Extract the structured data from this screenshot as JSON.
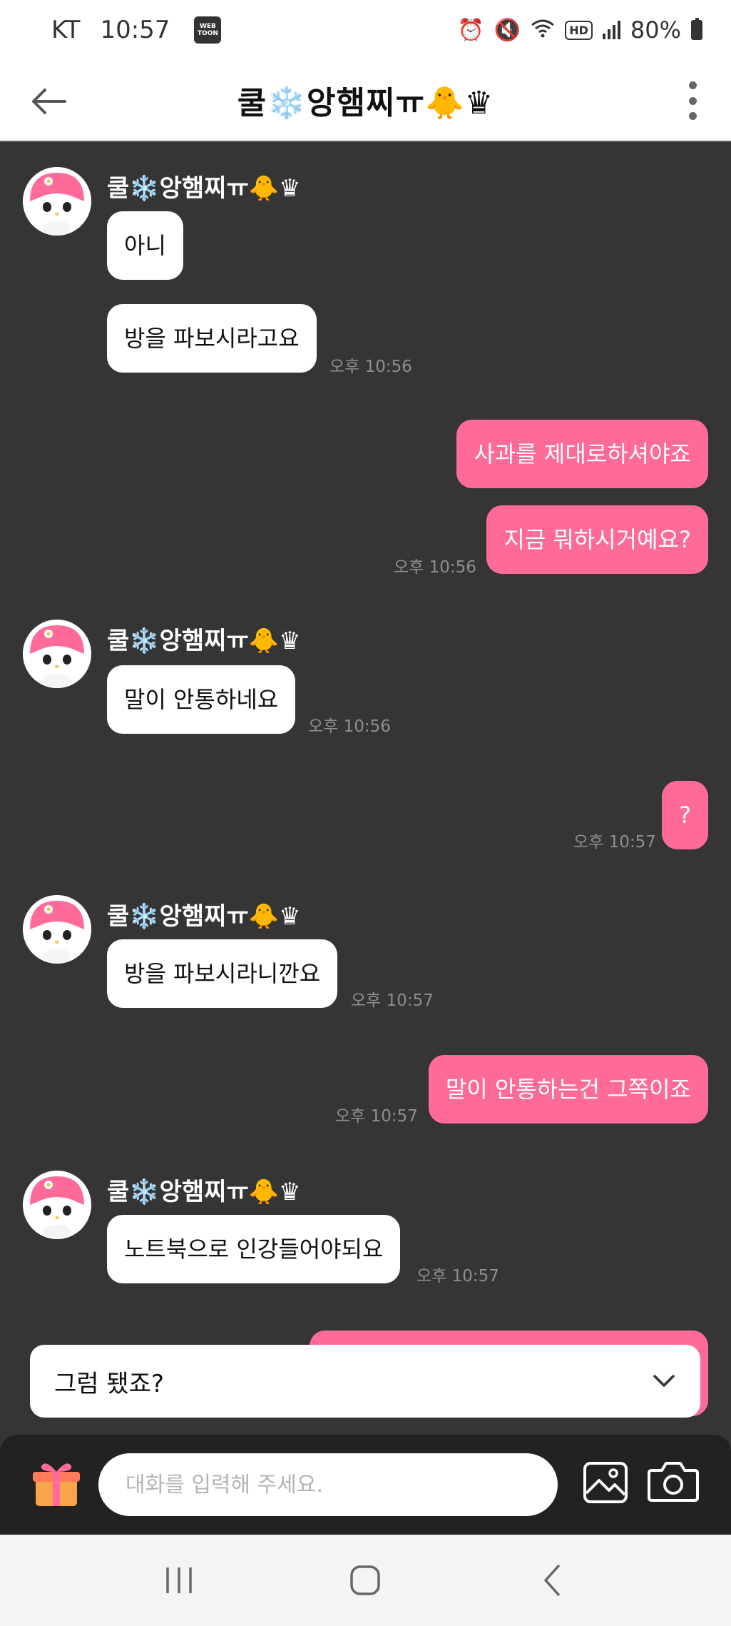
{
  "status_bar": {
    "carrier": "KT",
    "time": "10:57",
    "badge_top": "WEB",
    "badge_bottom": "TOON",
    "battery": "80%",
    "hd": "HD"
  },
  "header": {
    "title": "쿨❄️앙햄찌ㅠ🐥♛"
  },
  "sender_display_name": "쿨❄️앙햄찌ㅠ🐥♛",
  "messages": [
    {
      "direction": "in",
      "text": "아니",
      "time": ""
    },
    {
      "direction": "in",
      "text": "방을 파보시라고요",
      "time": "오후 10:56"
    },
    {
      "direction": "out",
      "text": "사과를 제대로하셔야죠",
      "time": ""
    },
    {
      "direction": "out",
      "text": "지금 뭐하시거예요?",
      "time": "오후 10:56"
    },
    {
      "direction": "in",
      "text": "말이 안통하네요",
      "time": "오후 10:56"
    },
    {
      "direction": "out",
      "text": "?",
      "time": "오후 10:57"
    },
    {
      "direction": "in",
      "text": "방을 파보시라니깐요",
      "time": "오후 10:57"
    },
    {
      "direction": "out",
      "text": "말이 안통하는건 그쪽이죠",
      "time": "오후 10:57"
    },
    {
      "direction": "in",
      "text": "노트북으로 인강들어야되요",
      "time": "오후 10:57"
    }
  ],
  "suggestion": {
    "text": "그럼 됐죠?"
  },
  "input": {
    "placeholder": "대화를 입력해 주세요."
  },
  "colors": {
    "outgoing_bubble": "#ff6b98",
    "chat_background": "#353535",
    "incoming_bubble": "#ffffff"
  },
  "icons": [
    "back-arrow-icon",
    "more-vertical-icon",
    "gift-icon",
    "image-icon",
    "camera-icon",
    "chevron-down-icon",
    "recent-apps-icon",
    "home-icon",
    "back-nav-icon"
  ]
}
